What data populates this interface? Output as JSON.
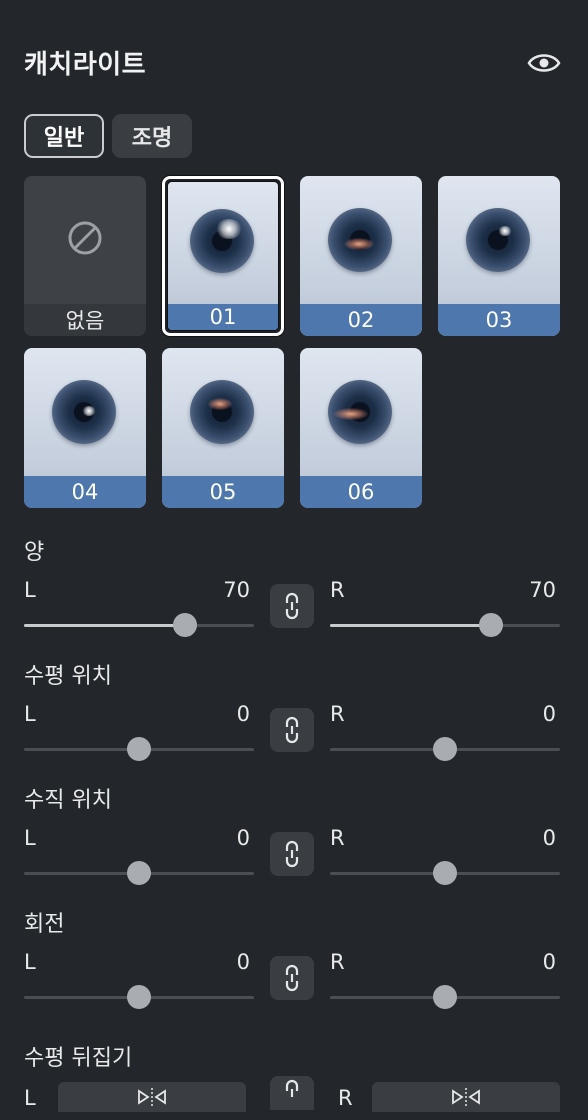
{
  "header": {
    "title": "캐치라이트",
    "visibility_icon": "eye-icon"
  },
  "tabs": [
    {
      "label": "일반",
      "active": true
    },
    {
      "label": "조명",
      "active": false
    }
  ],
  "presets": {
    "none_label": "없음",
    "none_icon": "prohibited-icon",
    "items": [
      {
        "label": "01",
        "selected": true
      },
      {
        "label": "02",
        "selected": false
      },
      {
        "label": "03",
        "selected": false
      },
      {
        "label": "04",
        "selected": false
      },
      {
        "label": "05",
        "selected": false
      },
      {
        "label": "06",
        "selected": false
      }
    ]
  },
  "controls": {
    "amount": {
      "label": "양",
      "left_label": "L",
      "left_value": "70",
      "right_label": "R",
      "right_value": "70",
      "left_fraction": 0.7,
      "right_fraction": 0.7
    },
    "horizontal": {
      "label": "수평 위치",
      "left_label": "L",
      "left_value": "0",
      "right_label": "R",
      "right_value": "0",
      "left_fraction": 0.5,
      "right_fraction": 0.5
    },
    "vertical": {
      "label": "수직 위치",
      "left_label": "L",
      "left_value": "0",
      "right_label": "R",
      "right_value": "0",
      "left_fraction": 0.5,
      "right_fraction": 0.5
    },
    "rotation": {
      "label": "회전",
      "left_label": "L",
      "left_value": "0",
      "right_label": "R",
      "right_value": "0",
      "left_fraction": 0.5,
      "right_fraction": 0.5
    },
    "flip": {
      "label": "수평 뒤집기",
      "left_label": "L",
      "right_label": "R",
      "icon": "flip-horizontal-icon"
    }
  },
  "link_icon": "link-icon",
  "colors": {
    "background": "#23272b",
    "accent": "#4e78ad",
    "panel": "#3a3e43"
  }
}
